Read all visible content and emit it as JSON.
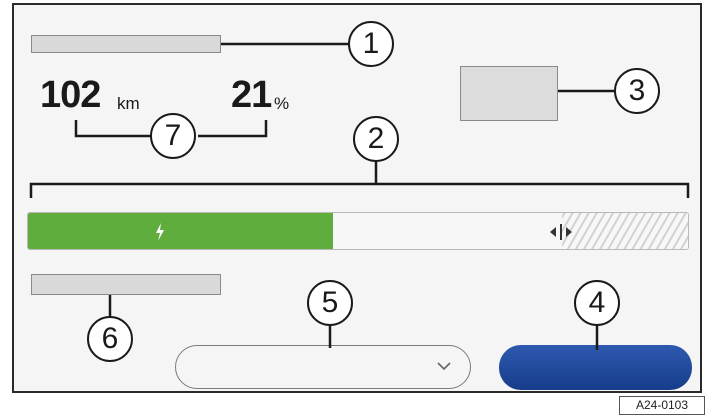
{
  "display": {
    "range": {
      "value": "102",
      "unit": "km"
    },
    "charge": {
      "value": "21",
      "unit": "%"
    }
  },
  "battery": {
    "fill_fraction": 0.46,
    "target_fraction": 0.8,
    "fill_color": "#5fad3d",
    "icon": "lightning-bolt-icon",
    "divider_icon": "split-handle-icon"
  },
  "dropdown": {
    "value": "",
    "icon": "chevron-down-icon"
  },
  "primary_button": {
    "label": "",
    "color": "#1f4a9e"
  },
  "callouts": [
    "1",
    "2",
    "3",
    "4",
    "5",
    "6",
    "7"
  ],
  "figure_id": "A24-0103"
}
